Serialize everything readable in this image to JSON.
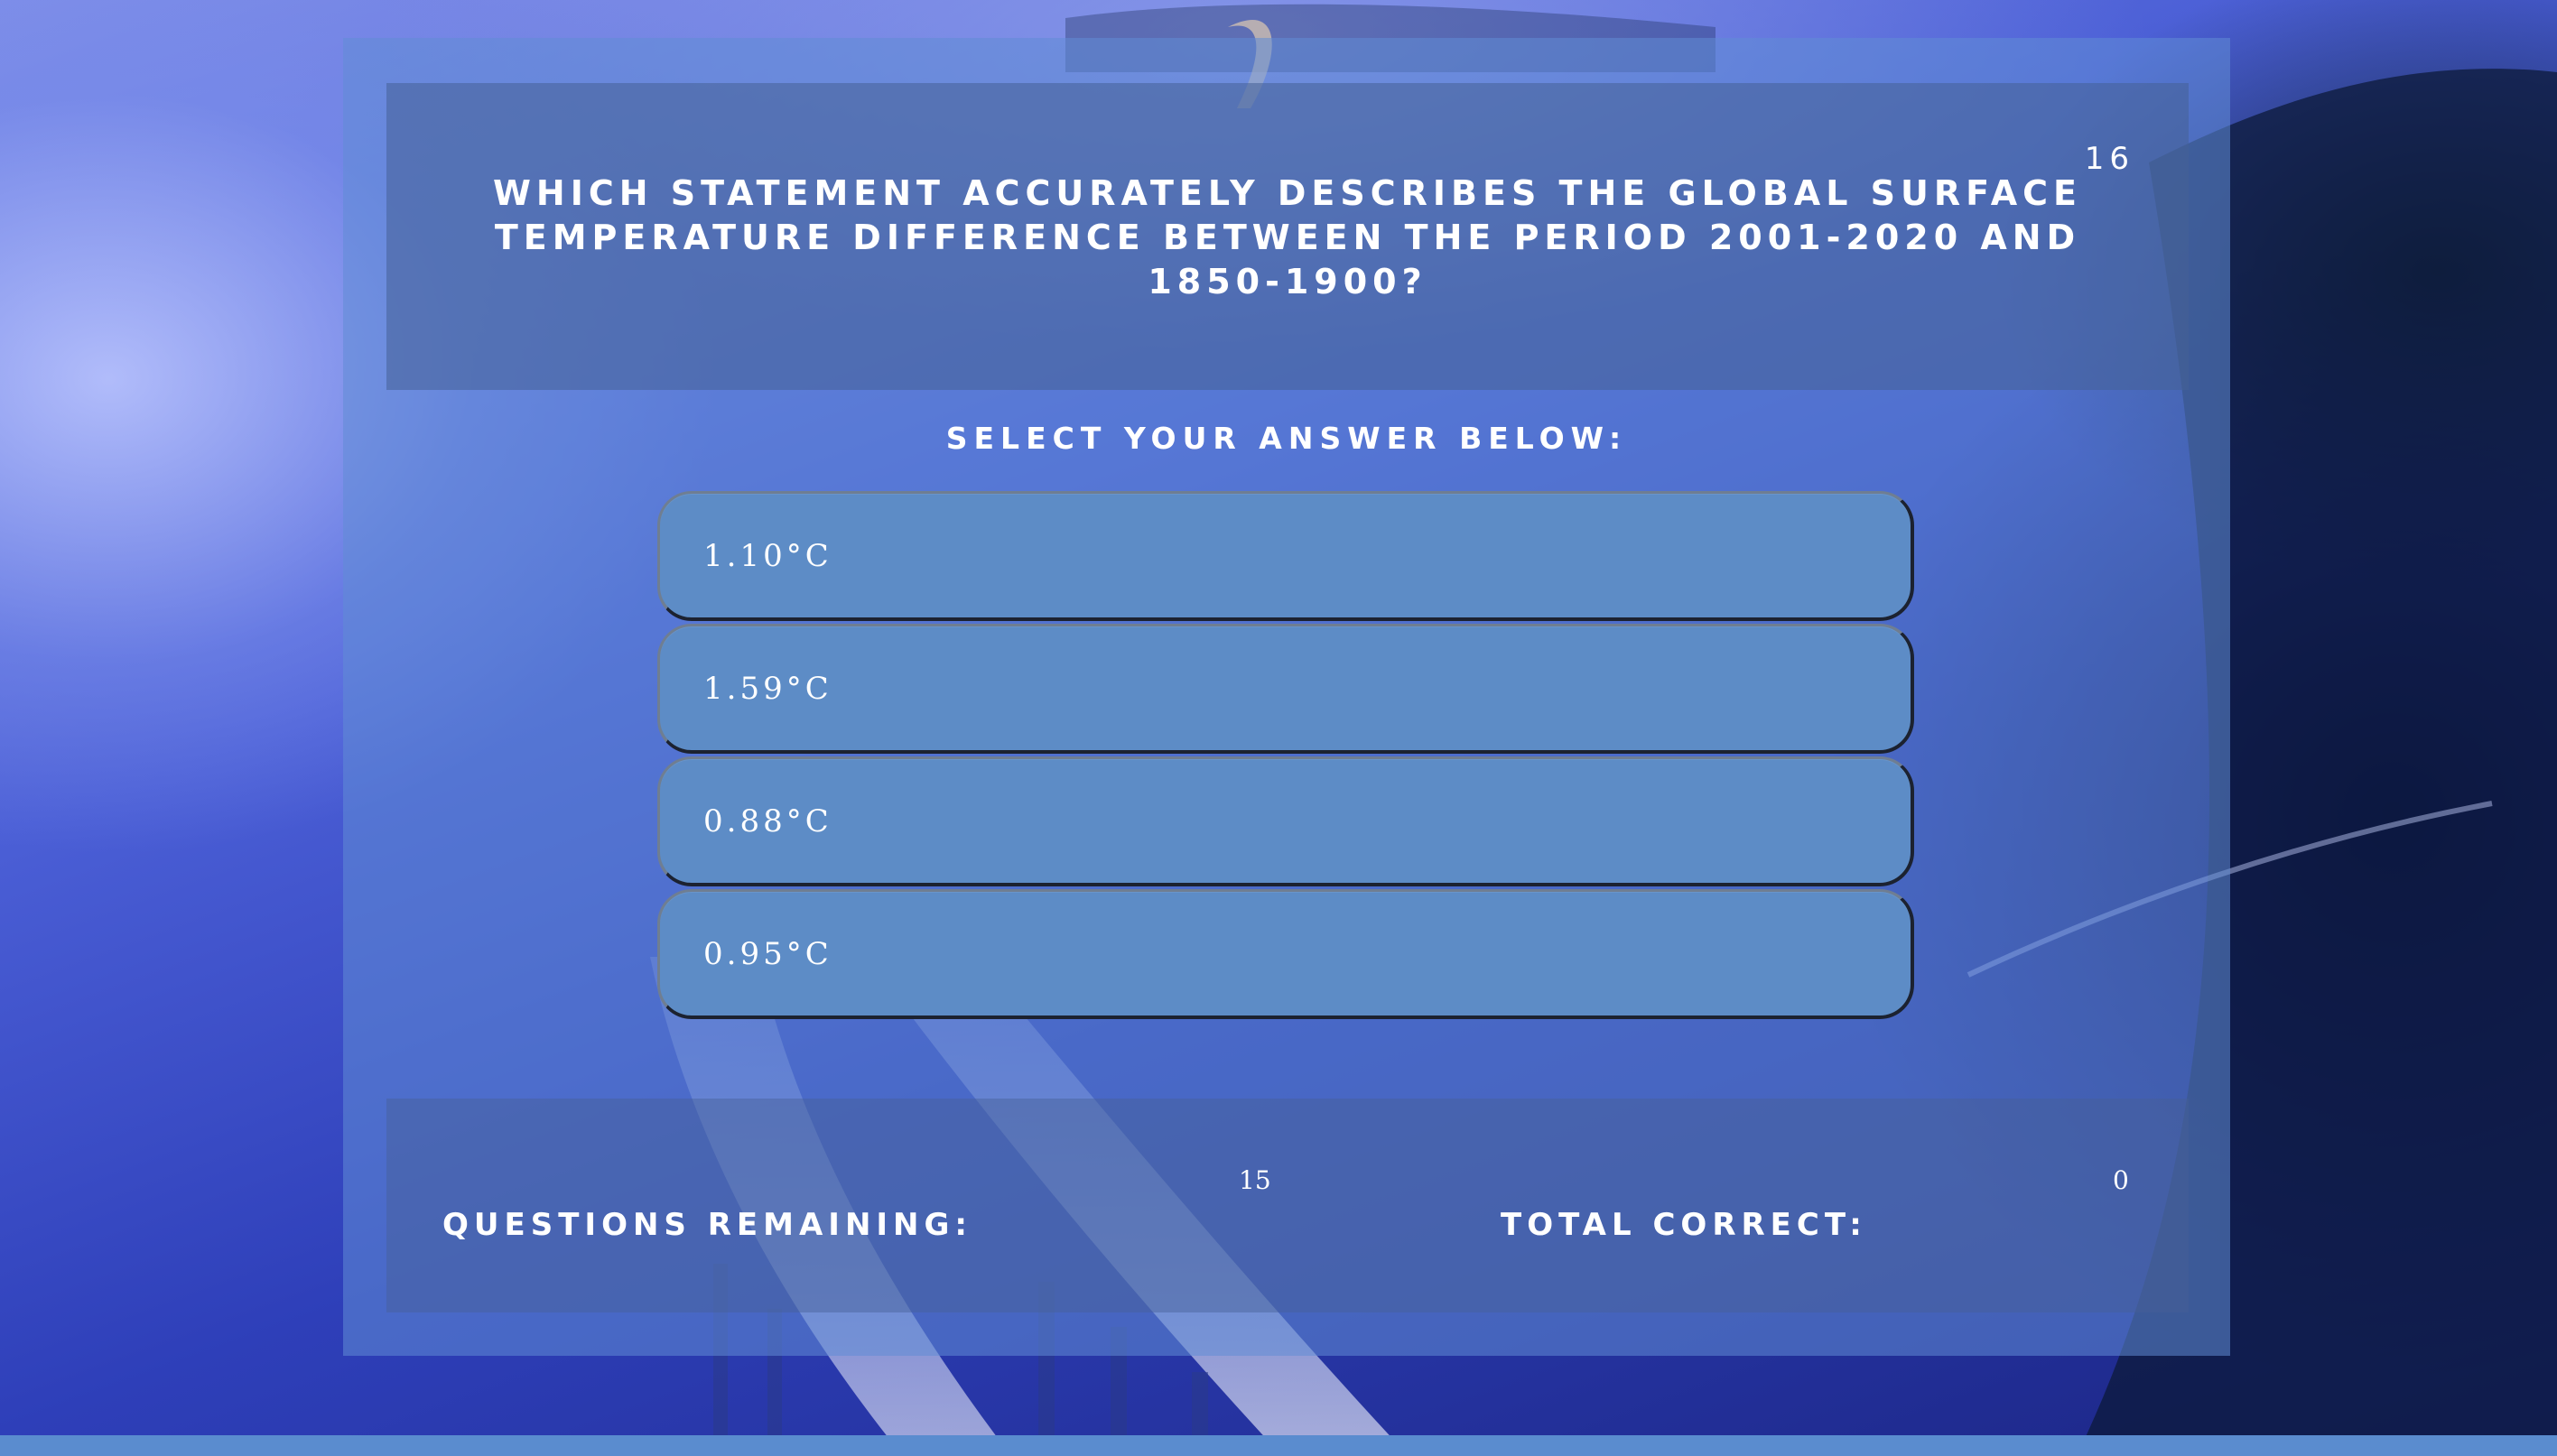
{
  "quiz": {
    "question_number": "16",
    "question_text": "WHICH STATEMENT ACCURATELY DESCRIBES THE GLOBAL SURFACE TEMPERATURE DIFFERENCE BETWEEN THE PERIOD 2001-2020 AND 1850-1900?",
    "select_label": "SELECT YOUR ANSWER BELOW:",
    "answers": [
      {
        "label": "1.10°C"
      },
      {
        "label": "1.59°C"
      },
      {
        "label": "0.88°C"
      },
      {
        "label": "0.95°C"
      }
    ]
  },
  "stats": {
    "remaining_label": "QUESTIONS REMAINING:",
    "remaining_value": "15",
    "correct_label": "TOTAL CORRECT:",
    "correct_value": "0"
  },
  "colors": {
    "panel": "#608cd6",
    "answer_button": "#5d8cc6",
    "text": "#ffffff",
    "bottom_strip": "#5a8ccf"
  },
  "background": {
    "icon": "misty-mountain-highway-photo"
  }
}
